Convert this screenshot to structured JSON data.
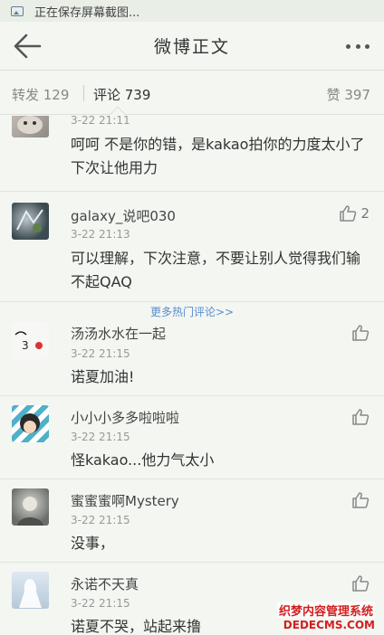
{
  "statusbar": {
    "text": "正在保存屏幕截图..."
  },
  "navbar": {
    "title": "微博正文"
  },
  "tabs": {
    "repost": "转发 129",
    "comment": "评论 739",
    "like": "赞 397"
  },
  "comments": [
    {
      "name": "",
      "time": "3-22 21:11",
      "text": "呵呵 不是你的错，是kakao拍你的力度太小了 下次让他用力",
      "likes": ""
    },
    {
      "name": "galaxy_说吧030",
      "time": "3-22 21:13",
      "text": "可以理解，下次注意，不要让别人觉得我们输不起QAQ",
      "likes": "2"
    },
    {
      "name": "汤汤水水在一起",
      "time": "3-22 21:15",
      "text": "诺夏加油!",
      "likes": ""
    },
    {
      "name": "小小小多多啦啦啦",
      "time": "3-22 21:15",
      "text": "怪kakao...他力气太小",
      "likes": ""
    },
    {
      "name": "蜜蜜蜜啊Mystery",
      "time": "3-22 21:15",
      "text": "没事，",
      "likes": ""
    },
    {
      "name": "永诺不天真",
      "time": "3-22 21:15",
      "text": "诺夏不哭，站起来撸",
      "likes": ""
    }
  ],
  "more_hot": "更多热门评论>>",
  "watermark": {
    "line1": "织梦内容管理系统",
    "line2": "DEDECMS.COM"
  },
  "icons": [
    "image-icon",
    "back-arrow-icon",
    "more-icon",
    "thumb-up-icon"
  ],
  "colors": {
    "link": "#5a8cd0",
    "background": "#f3f6f1",
    "watermark": "#d21f1f"
  }
}
